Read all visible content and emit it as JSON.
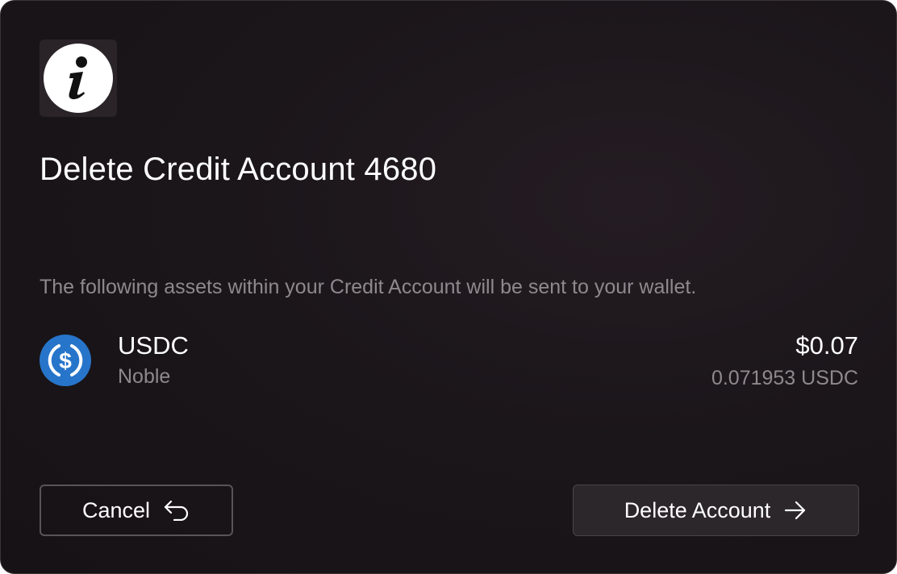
{
  "dialog": {
    "title": "Delete Credit Account 4680",
    "description": "The following assets within your Credit Account will be sent to your wallet."
  },
  "icons": {
    "header": "info-icon",
    "token": "usdc-icon",
    "cancel": "undo-arrow-icon",
    "delete": "arrow-right-icon"
  },
  "assets": [
    {
      "symbol": "USDC",
      "chain": "Noble",
      "value": "$0.07",
      "amount": "0.071953 USDC"
    }
  ],
  "buttons": {
    "cancel_label": "Cancel",
    "delete_label": "Delete Account"
  },
  "colors": {
    "background": "#1b161a",
    "muted_text": "#8f888c",
    "usdc_blue": "#2775ca"
  }
}
